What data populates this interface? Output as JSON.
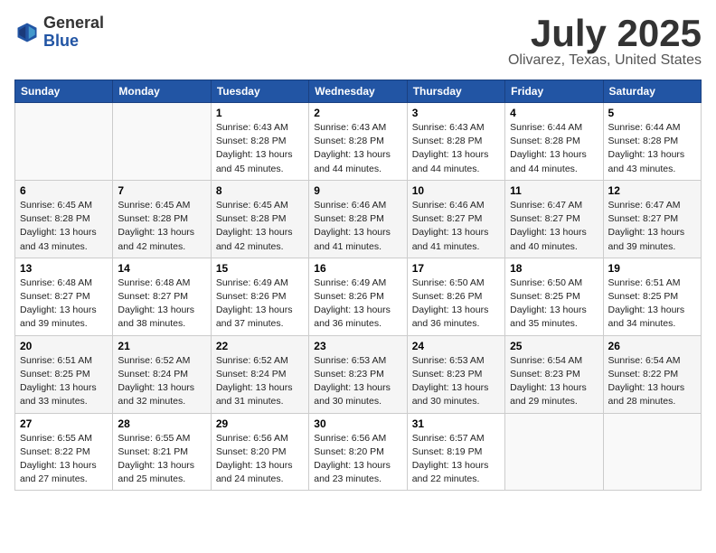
{
  "header": {
    "logo_line1": "General",
    "logo_line2": "Blue",
    "month": "July 2025",
    "location": "Olivarez, Texas, United States"
  },
  "days_of_week": [
    "Sunday",
    "Monday",
    "Tuesday",
    "Wednesday",
    "Thursday",
    "Friday",
    "Saturday"
  ],
  "weeks": [
    [
      {
        "day": "",
        "info": ""
      },
      {
        "day": "",
        "info": ""
      },
      {
        "day": "1",
        "info": "Sunrise: 6:43 AM\nSunset: 8:28 PM\nDaylight: 13 hours and 45 minutes."
      },
      {
        "day": "2",
        "info": "Sunrise: 6:43 AM\nSunset: 8:28 PM\nDaylight: 13 hours and 44 minutes."
      },
      {
        "day": "3",
        "info": "Sunrise: 6:43 AM\nSunset: 8:28 PM\nDaylight: 13 hours and 44 minutes."
      },
      {
        "day": "4",
        "info": "Sunrise: 6:44 AM\nSunset: 8:28 PM\nDaylight: 13 hours and 44 minutes."
      },
      {
        "day": "5",
        "info": "Sunrise: 6:44 AM\nSunset: 8:28 PM\nDaylight: 13 hours and 43 minutes."
      }
    ],
    [
      {
        "day": "6",
        "info": "Sunrise: 6:45 AM\nSunset: 8:28 PM\nDaylight: 13 hours and 43 minutes."
      },
      {
        "day": "7",
        "info": "Sunrise: 6:45 AM\nSunset: 8:28 PM\nDaylight: 13 hours and 42 minutes."
      },
      {
        "day": "8",
        "info": "Sunrise: 6:45 AM\nSunset: 8:28 PM\nDaylight: 13 hours and 42 minutes."
      },
      {
        "day": "9",
        "info": "Sunrise: 6:46 AM\nSunset: 8:28 PM\nDaylight: 13 hours and 41 minutes."
      },
      {
        "day": "10",
        "info": "Sunrise: 6:46 AM\nSunset: 8:27 PM\nDaylight: 13 hours and 41 minutes."
      },
      {
        "day": "11",
        "info": "Sunrise: 6:47 AM\nSunset: 8:27 PM\nDaylight: 13 hours and 40 minutes."
      },
      {
        "day": "12",
        "info": "Sunrise: 6:47 AM\nSunset: 8:27 PM\nDaylight: 13 hours and 39 minutes."
      }
    ],
    [
      {
        "day": "13",
        "info": "Sunrise: 6:48 AM\nSunset: 8:27 PM\nDaylight: 13 hours and 39 minutes."
      },
      {
        "day": "14",
        "info": "Sunrise: 6:48 AM\nSunset: 8:27 PM\nDaylight: 13 hours and 38 minutes."
      },
      {
        "day": "15",
        "info": "Sunrise: 6:49 AM\nSunset: 8:26 PM\nDaylight: 13 hours and 37 minutes."
      },
      {
        "day": "16",
        "info": "Sunrise: 6:49 AM\nSunset: 8:26 PM\nDaylight: 13 hours and 36 minutes."
      },
      {
        "day": "17",
        "info": "Sunrise: 6:50 AM\nSunset: 8:26 PM\nDaylight: 13 hours and 36 minutes."
      },
      {
        "day": "18",
        "info": "Sunrise: 6:50 AM\nSunset: 8:25 PM\nDaylight: 13 hours and 35 minutes."
      },
      {
        "day": "19",
        "info": "Sunrise: 6:51 AM\nSunset: 8:25 PM\nDaylight: 13 hours and 34 minutes."
      }
    ],
    [
      {
        "day": "20",
        "info": "Sunrise: 6:51 AM\nSunset: 8:25 PM\nDaylight: 13 hours and 33 minutes."
      },
      {
        "day": "21",
        "info": "Sunrise: 6:52 AM\nSunset: 8:24 PM\nDaylight: 13 hours and 32 minutes."
      },
      {
        "day": "22",
        "info": "Sunrise: 6:52 AM\nSunset: 8:24 PM\nDaylight: 13 hours and 31 minutes."
      },
      {
        "day": "23",
        "info": "Sunrise: 6:53 AM\nSunset: 8:23 PM\nDaylight: 13 hours and 30 minutes."
      },
      {
        "day": "24",
        "info": "Sunrise: 6:53 AM\nSunset: 8:23 PM\nDaylight: 13 hours and 30 minutes."
      },
      {
        "day": "25",
        "info": "Sunrise: 6:54 AM\nSunset: 8:23 PM\nDaylight: 13 hours and 29 minutes."
      },
      {
        "day": "26",
        "info": "Sunrise: 6:54 AM\nSunset: 8:22 PM\nDaylight: 13 hours and 28 minutes."
      }
    ],
    [
      {
        "day": "27",
        "info": "Sunrise: 6:55 AM\nSunset: 8:22 PM\nDaylight: 13 hours and 27 minutes."
      },
      {
        "day": "28",
        "info": "Sunrise: 6:55 AM\nSunset: 8:21 PM\nDaylight: 13 hours and 25 minutes."
      },
      {
        "day": "29",
        "info": "Sunrise: 6:56 AM\nSunset: 8:20 PM\nDaylight: 13 hours and 24 minutes."
      },
      {
        "day": "30",
        "info": "Sunrise: 6:56 AM\nSunset: 8:20 PM\nDaylight: 13 hours and 23 minutes."
      },
      {
        "day": "31",
        "info": "Sunrise: 6:57 AM\nSunset: 8:19 PM\nDaylight: 13 hours and 22 minutes."
      },
      {
        "day": "",
        "info": ""
      },
      {
        "day": "",
        "info": ""
      }
    ]
  ]
}
